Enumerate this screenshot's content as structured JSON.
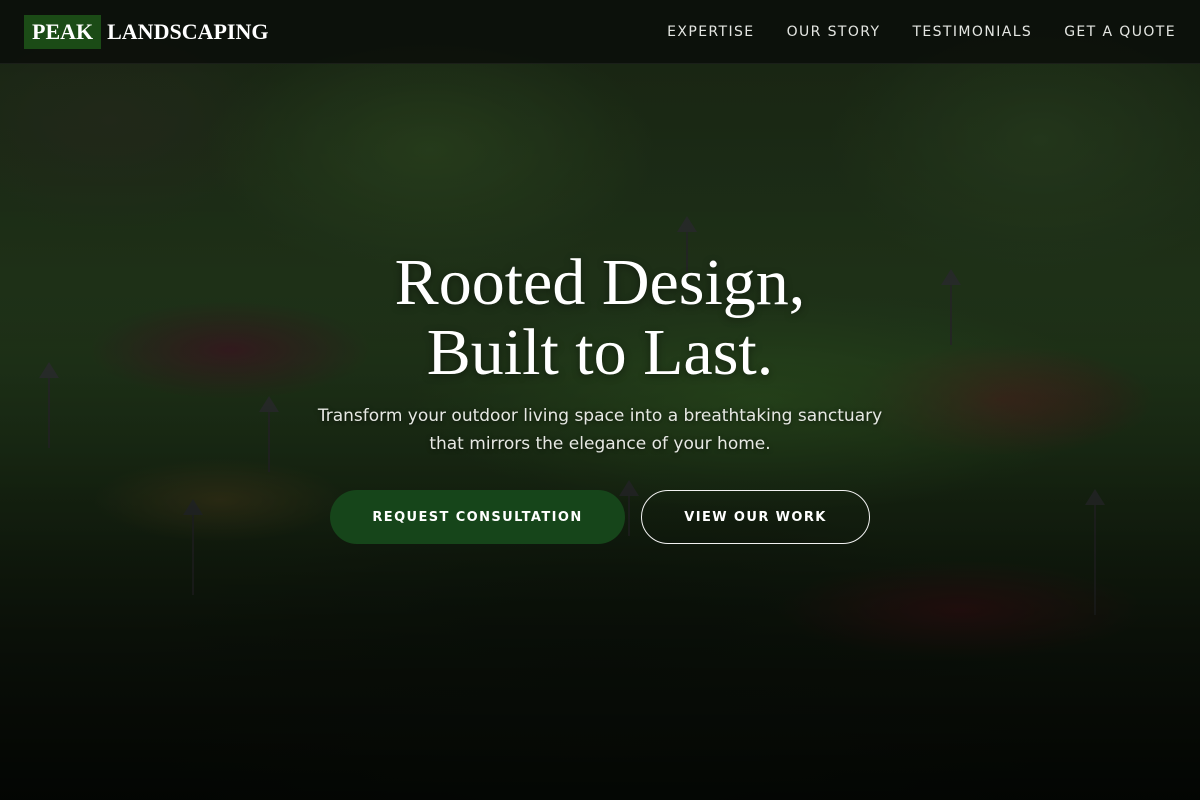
{
  "brand": {
    "mark": "PEAK",
    "word": "LANDSCAPING",
    "mark_color": "#1b4b16"
  },
  "nav": {
    "links": [
      {
        "label": "EXPERTISE"
      },
      {
        "label": "OUR STORY"
      },
      {
        "label": "TESTIMONIALS"
      },
      {
        "label": "GET A QUOTE"
      }
    ]
  },
  "hero": {
    "title_line1": "Rooted Design,",
    "title_line2": "Built to Last.",
    "subtitle_line1": "Transform your outdoor living space into a breathtaking sanctuary",
    "subtitle_line2": "that mirrors the elegance of your home.",
    "primary_cta": "REQUEST CONSULTATION",
    "secondary_cta": "VIEW OUR WORK",
    "accent_color": "#16451a"
  }
}
